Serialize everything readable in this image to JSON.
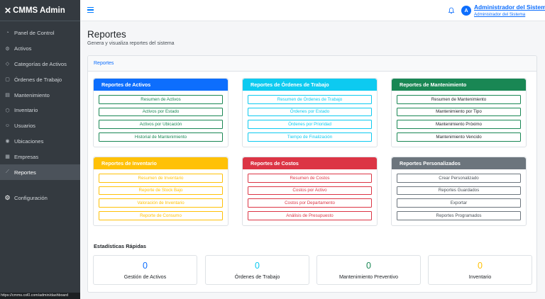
{
  "brand": {
    "name": "CMMS Admin"
  },
  "sidebar": {
    "items": [
      {
        "label": "Panel de Control",
        "icon": "gauge-icon"
      },
      {
        "label": "Activos",
        "icon": "gear-icon"
      },
      {
        "label": "Categorías de Activos",
        "icon": "tag-icon"
      },
      {
        "label": "Órdenes de Trabajo",
        "icon": "clipboard-icon"
      },
      {
        "label": "Mantenimiento",
        "icon": "calendar-icon"
      },
      {
        "label": "Inventario",
        "icon": "box-icon"
      },
      {
        "label": "Usuarios",
        "icon": "users-icon"
      },
      {
        "label": "Ubicaciones",
        "icon": "location-icon"
      },
      {
        "label": "Empresas",
        "icon": "building-icon"
      },
      {
        "label": "Reportes",
        "icon": "chart-icon"
      }
    ],
    "config_label": "Configuración"
  },
  "status_bar": {
    "url": "https://cmms.col0.com/admin/dashboard"
  },
  "topbar": {
    "user_name": "Administrador del Sistema",
    "user_role": "Administrador del Sistema",
    "avatar_initial": "A"
  },
  "page": {
    "title": "Reportes",
    "subtitle": "Genera y visualiza reportes del sistema"
  },
  "main_card": {
    "header": "Reportes"
  },
  "panels": [
    {
      "title": "Reportes de Activos",
      "buttons": [
        "Resumen de Activos",
        "Activos por Estado",
        "Activos por Ubicación",
        "Historial de Mantenimiento"
      ]
    },
    {
      "title": "Reportes de Órdenes de Trabajo",
      "buttons": [
        "Resumen de Órdenes de Trabajo",
        "Órdenes por Estado",
        "Órdenes por Prioridad",
        "Tiempo de Finalización"
      ]
    },
    {
      "title": "Reportes de Mantenimiento",
      "buttons": [
        "Resumen de Mantenimiento",
        "Mantenimiento por Tipo",
        "Mantenimiento Próximo",
        "Mantenimiento Vencido"
      ]
    },
    {
      "title": "Reportes de Inventario",
      "buttons": [
        "Resumen de Inventario",
        "Reporte de Stock Bajo",
        "Valoración de Inventario",
        "Reporte de Consumo"
      ]
    },
    {
      "title": "Reportes de Costos",
      "buttons": [
        "Resumen de Costos",
        "Costos por Activo",
        "Costos por Departamento",
        "Análisis de Presupuesto"
      ]
    },
    {
      "title": "Reportes Personalizados",
      "buttons": [
        "Crear Personalizado",
        "Reportes Guardados",
        "Exportar",
        "Reportes Programados"
      ]
    }
  ],
  "stats": {
    "title": "Estadísticas Rápidas",
    "cards": [
      {
        "value": "0",
        "label": "Gestión de Activos",
        "color": "#0d6efd"
      },
      {
        "value": "0",
        "label": "Órdenes de Trabajo",
        "color": "#0dcaf0"
      },
      {
        "value": "0",
        "label": "Mantenimiento Preventivo",
        "color": "#198754"
      },
      {
        "value": "0",
        "label": "Inventario",
        "color": "#ffc107"
      }
    ]
  }
}
